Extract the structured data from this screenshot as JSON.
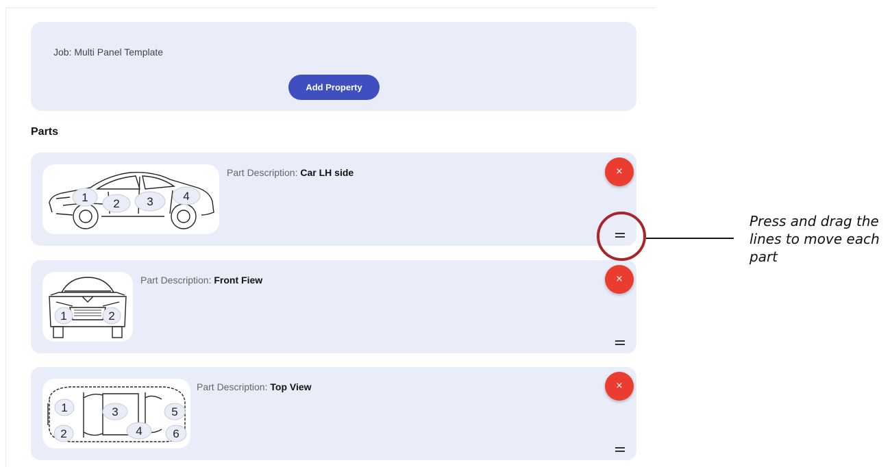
{
  "job": {
    "label": "Job: Multi Panel Template",
    "add_property_label": "Add Property"
  },
  "parts_heading": "Parts",
  "parts": [
    {
      "description_label": "Part Description:",
      "description_value": "Car LH side",
      "view": "side",
      "panel_numbers": [
        "1",
        "2",
        "3",
        "4"
      ],
      "delete_label": "×"
    },
    {
      "description_label": "Part Description:",
      "description_value": "Front Fiew",
      "view": "front",
      "panel_numbers": [
        "1",
        "2"
      ],
      "delete_label": "×"
    },
    {
      "description_label": "Part Description:",
      "description_value": "Top View",
      "view": "top",
      "panel_numbers": [
        "1",
        "2",
        "3",
        "4",
        "5",
        "6"
      ],
      "delete_label": "×"
    }
  ],
  "annotation": {
    "text": "Press and drag the lines to move each part"
  },
  "colors": {
    "card_background": "#e9ecf9",
    "primary_button": "#3f4fc0",
    "delete_button": "#ea3d2f",
    "annotation_circle": "#a8262a"
  },
  "icons": {
    "delete": "close-icon",
    "drag": "drag-handle-icon"
  }
}
